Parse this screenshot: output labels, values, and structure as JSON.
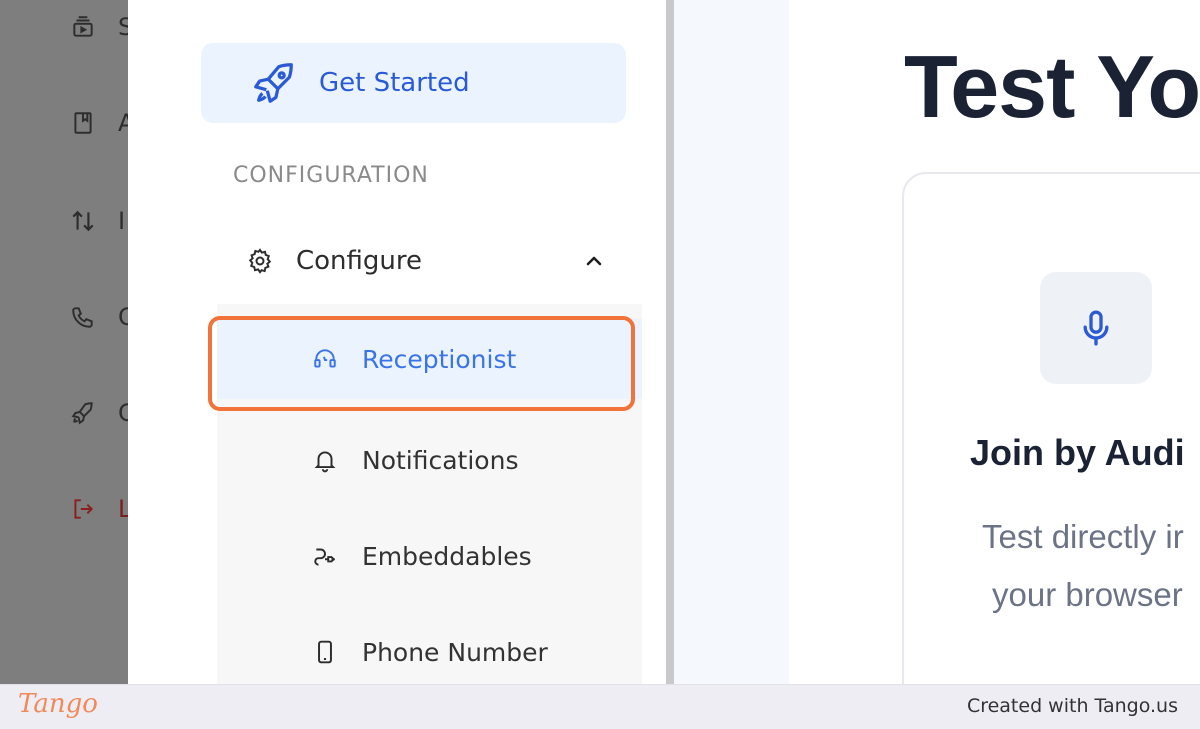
{
  "rail": {
    "items": [
      {
        "icon": "sessions-icon",
        "text": "S"
      },
      {
        "icon": "book-icon",
        "text": "A"
      },
      {
        "icon": "transfer-arrows-icon",
        "text": "I"
      },
      {
        "icon": "phone-icon",
        "text": "C"
      },
      {
        "icon": "rocket-icon",
        "text": "G"
      },
      {
        "icon": "logout-icon",
        "text": "L"
      }
    ]
  },
  "sidebar": {
    "get_started_label": "Get Started",
    "section_heading": "CONFIGURATION",
    "configure_label": "Configure",
    "submenu": [
      {
        "icon": "headset-icon",
        "label": "Receptionist",
        "active": true
      },
      {
        "icon": "bell-icon",
        "label": "Notifications",
        "active": false
      },
      {
        "icon": "plug-icon",
        "label": "Embeddables",
        "active": false
      },
      {
        "icon": "mobile-phone-icon",
        "label": "Phone Number",
        "active": false
      }
    ]
  },
  "main": {
    "title": "Test Yo",
    "card": {
      "icon": "microphone-icon",
      "title": "Join by Audi",
      "desc_line1": "Test directly ir",
      "desc_line2": "your browser"
    }
  },
  "footer": {
    "logo_text": "Tango",
    "credit": "Created with Tango.us"
  },
  "colors": {
    "accent": "#2a5ad6",
    "active_bg": "#eaf3fe",
    "highlight_border": "#f2733a",
    "logout_red": "#b42318"
  }
}
